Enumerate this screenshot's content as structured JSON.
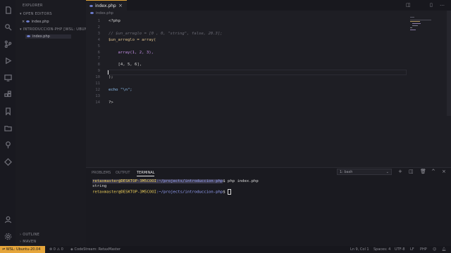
{
  "sidebar": {
    "explorer_title": "EXPLORER",
    "open_editors_title": "OPEN EDITORS",
    "open_editor_file": "index.php",
    "project_title": "INTRODUCCION-PHP [WSL: UBUNTU...",
    "project_file": "index.php",
    "outline_title": "OUTLINE",
    "maven_title": "MAVEN"
  },
  "tabs": {
    "active": "index.php",
    "breadcrumb": "index.php"
  },
  "editor": {
    "lines": [
      {
        "n": "1",
        "text": "<?php"
      },
      {
        "n": "2",
        "text": ""
      },
      {
        "n": "3",
        "text": "// $un_arreglo = [0 , 0, \"string\", false, 20.3];"
      },
      {
        "n": "4",
        "text": "$un_arreglo = array("
      },
      {
        "n": "5",
        "text": ""
      },
      {
        "n": "6",
        "text": "    array(1, 2, 3),"
      },
      {
        "n": "7",
        "text": ""
      },
      {
        "n": "8",
        "text": "    [4, 5, 6],"
      },
      {
        "n": "9",
        "text": ""
      },
      {
        "n": "10",
        "text": ");"
      },
      {
        "n": "11",
        "text": ""
      },
      {
        "n": "12",
        "text": "echo \"\\n\";"
      },
      {
        "n": "13",
        "text": ""
      },
      {
        "n": "14",
        "text": "?>"
      }
    ]
  },
  "panel": {
    "tabs": [
      "PROBLEMS",
      "OUTPUT",
      "TERMINAL"
    ],
    "terminal_select": "1: bash",
    "prompt_user": "retaxmaster@DESKTOP-3M5COOI",
    "prompt_path": ":~/projects/introduccion-php",
    "command": "$ php index.php",
    "output": "string",
    "prompt_end": "$"
  },
  "status": {
    "remote": "WSL: Ubuntu-20.04",
    "errors": "0",
    "warnings": "0",
    "codestream": "CodeStream: RetaxMaster",
    "position": "Ln 9, Col 1",
    "spaces": "Spaces: 4",
    "encoding": "UTF-8",
    "eol": "LF",
    "language": "PHP"
  },
  "colors": {
    "accent": "#e5a53b",
    "php_icon": "#6f7fd1"
  }
}
